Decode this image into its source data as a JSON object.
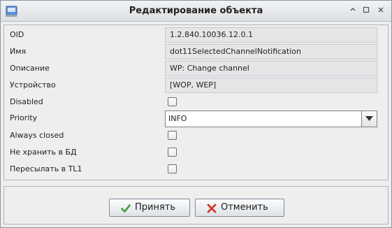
{
  "window": {
    "title": "Редактирование объекта",
    "controls": [
      "minimize",
      "restore",
      "close"
    ]
  },
  "form": {
    "oid": {
      "label": "OID",
      "value": "1.2.840.10036.12.0.1"
    },
    "name": {
      "label": "Имя",
      "value": "dot11SelectedChannelNotification"
    },
    "description": {
      "label": "Описание",
      "value": "WP: Change channel"
    },
    "device": {
      "label": "Устройство",
      "value": "[WOP, WEP]"
    },
    "disabled": {
      "label": "Disabled",
      "checked": false
    },
    "priority": {
      "label": "Priority",
      "value": "INFO"
    },
    "always_closed": {
      "label": "Always closed",
      "checked": false
    },
    "no_store": {
      "label": "Не хранить в БД",
      "checked": false
    },
    "forward_tl1": {
      "label": "Пересылать в TL1",
      "checked": false
    }
  },
  "buttons": {
    "accept": {
      "label": "Принять",
      "icon": "check-icon",
      "color": "#3aa03a"
    },
    "cancel": {
      "label": "Отменить",
      "icon": "x-icon",
      "color": "#d23a2a"
    }
  },
  "colors": {
    "title_bg": "#e6e8eb",
    "field_bg": "#e6e6e8",
    "window_bg": "#eeeeee"
  }
}
